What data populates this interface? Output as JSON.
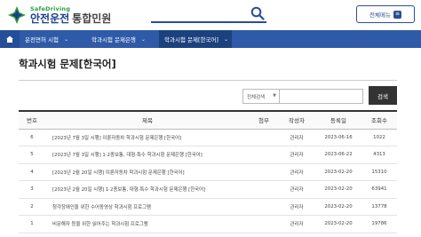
{
  "brand": {
    "tagline": "SafeDriving",
    "name": "안전운전",
    "suffix": "통합민원"
  },
  "header": {
    "search_placeholder": "",
    "menu_label": "전체메뉴"
  },
  "nav": {
    "items": [
      {
        "label": "운전면허 시험"
      },
      {
        "label": "학과시험 문제은행"
      },
      {
        "label": "학과시험 문제[한국어]"
      }
    ]
  },
  "page": {
    "title": "학과시험 문제[한국어]"
  },
  "filter": {
    "select_value": "전체검색",
    "keyword_value": "",
    "search_button": "검색"
  },
  "table": {
    "headers": [
      "번호",
      "제목",
      "첨부",
      "작성자",
      "등록일",
      "조회수"
    ],
    "rows": [
      {
        "no": "6",
        "title": "[2023년 7월 3일 시행] 이륜자동차 학과시험 문제은행 [한국어]",
        "attach": "",
        "author": "관리자",
        "date": "2023-06-16",
        "views": "1022"
      },
      {
        "no": "5",
        "title": "[2023년 7월 3일 시행] 1·2종보통, 대형·특수 학과시험 문제은행 [한국어]",
        "attach": "",
        "author": "관리자",
        "date": "2023-06-22",
        "views": "4313"
      },
      {
        "no": "4",
        "title": "[2023년 2월 20일 시행] 이륜자동차 학과시험 문제은행 [한국어]",
        "attach": "",
        "author": "관리자",
        "date": "2023-02-20",
        "views": "15310"
      },
      {
        "no": "3",
        "title": "[2023년 2월 20일 시행] 1·2종보통, 대형·특수 학과시험 문제은행 [한국어]",
        "attach": "",
        "author": "관리자",
        "date": "2023-02-20",
        "views": "63941"
      },
      {
        "no": "2",
        "title": "청각장애인을 위한 수어동영상 학과시험 프로그램",
        "attach": "",
        "author": "관리자",
        "date": "2023-02-20",
        "views": "13778"
      },
      {
        "no": "1",
        "title": "비문해자 등을 위한 읽어주는 학과시험 프로그램",
        "attach": "",
        "author": "관리자",
        "date": "2023-02-20",
        "views": "19786"
      }
    ]
  },
  "colors": {
    "brand_blue": "#1a3f8f",
    "brand_green": "#2a9d3a",
    "nav_bg": "#2f5aa7",
    "nav_active": "#1c417f"
  }
}
